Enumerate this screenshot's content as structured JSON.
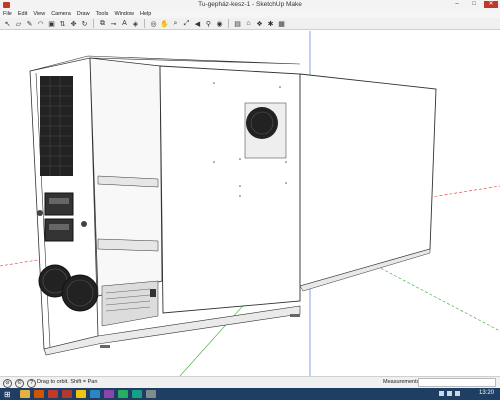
{
  "window": {
    "title": "Tu-gepház-kesz-1 - SketchUp Make"
  },
  "menu": [
    "File",
    "Edit",
    "View",
    "Camera",
    "Draw",
    "Tools",
    "Window",
    "Help"
  ],
  "toolbar": {
    "tools": [
      {
        "name": "select-tool-icon",
        "glyph": "↖"
      },
      {
        "name": "eraser-tool-icon",
        "glyph": "▱"
      },
      {
        "name": "pencil-tool-icon",
        "glyph": "✎"
      },
      {
        "name": "arc-tool-icon",
        "glyph": "◠"
      },
      {
        "name": "shape-tool-icon",
        "glyph": "▣"
      },
      {
        "name": "pushpull-tool-icon",
        "glyph": "⇅"
      },
      {
        "name": "move-tool-icon",
        "glyph": "✥"
      },
      {
        "name": "rotate-tool-icon",
        "glyph": "↻"
      },
      {
        "name": "offset-tool-icon",
        "glyph": "⧉"
      },
      {
        "name": "tape-tool-icon",
        "glyph": "⊸"
      },
      {
        "name": "text-tool-icon",
        "glyph": "A"
      },
      {
        "name": "paint-tool-icon",
        "glyph": "◈"
      },
      {
        "name": "orbit-tool-icon",
        "glyph": "◎"
      },
      {
        "name": "pan-tool-icon",
        "glyph": "✋"
      },
      {
        "name": "zoom-tool-icon",
        "glyph": "⌕"
      },
      {
        "name": "zoom-extents-tool-icon",
        "glyph": "⤢"
      },
      {
        "name": "prev-view-tool-icon",
        "glyph": "◀"
      },
      {
        "name": "walk-tool-icon",
        "glyph": "⚲"
      },
      {
        "name": "lookaround-tool-icon",
        "glyph": "◉"
      },
      {
        "name": "section-tool-icon",
        "glyph": "▤"
      },
      {
        "name": "warehouse-tool-icon",
        "glyph": "⌂"
      },
      {
        "name": "components-tool-icon",
        "glyph": "❖"
      },
      {
        "name": "extension-tool-icon",
        "glyph": "✱"
      },
      {
        "name": "layout-tool-icon",
        "glyph": "▦"
      }
    ]
  },
  "status": {
    "hint": "Drag to orbit. Shift = Pan",
    "measurements_label": "Measurements",
    "measurements_value": ""
  },
  "taskbar": {
    "clock": "13:20",
    "apps": [
      {
        "name": "explorer-taskbar-icon",
        "color": "#e3b341"
      },
      {
        "name": "browser-taskbar-icon",
        "color": "#d35400"
      },
      {
        "name": "media-taskbar-icon",
        "color": "#c0392b"
      },
      {
        "name": "sketchup-taskbar-icon",
        "color": "#b03a2e"
      },
      {
        "name": "files-taskbar-icon",
        "color": "#f1c40f"
      },
      {
        "name": "chat-taskbar-icon",
        "color": "#2e86c1"
      },
      {
        "name": "photo-taskbar-icon",
        "color": "#8e44ad"
      },
      {
        "name": "mail-taskbar-icon",
        "color": "#27ae60"
      },
      {
        "name": "store-taskbar-icon",
        "color": "#16a085"
      },
      {
        "name": "tool-taskbar-icon",
        "color": "#7f8c8d"
      }
    ]
  },
  "colors": {
    "accent": "#c0392b",
    "axis_red": "#d33",
    "axis_green": "#3a3",
    "axis_blue": "#36c"
  }
}
